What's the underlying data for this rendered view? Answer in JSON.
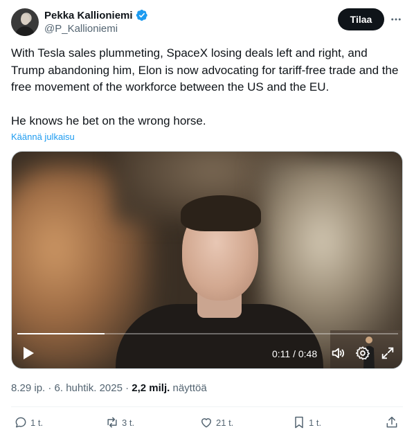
{
  "author": {
    "display_name": "Pekka Kallioniemi",
    "handle": "@P_Kallioniemi",
    "verified": true,
    "verified_color": "#1d9bf0"
  },
  "header": {
    "subscribe_label": "Tilaa",
    "more_icon": "more-horizontal-icon"
  },
  "tweet": {
    "paragraphs": [
      "With Tesla sales plummeting, SpaceX losing deals left and right, and Trump abandoning him, Elon is now advocating for tariff-free trade and the free movement of the workforce between the US and the EU.",
      "He knows he bet on the wrong horse."
    ],
    "translate_label": "Käännä julkaisu"
  },
  "video": {
    "current_time": "0:11",
    "duration": "0:48",
    "time_display": "0:11 / 0:48",
    "progress_fraction": 0.229,
    "icons": [
      "play-icon",
      "volume-icon",
      "settings-icon",
      "fullscreen-icon"
    ]
  },
  "meta": {
    "time_date": "8.29 ip. · 6. huhtik. 2025 · ",
    "views_count": "2,2 milj.",
    "views_label": " näyttöä"
  },
  "actions": {
    "replies": "1 t.",
    "reposts": "3 t.",
    "likes": "21 t.",
    "bookmarks": "1 t."
  },
  "colors": {
    "accent": "#1d9bf0",
    "text_primary": "#0f1419",
    "text_secondary": "#536471",
    "button_dark": "#0f1419"
  }
}
